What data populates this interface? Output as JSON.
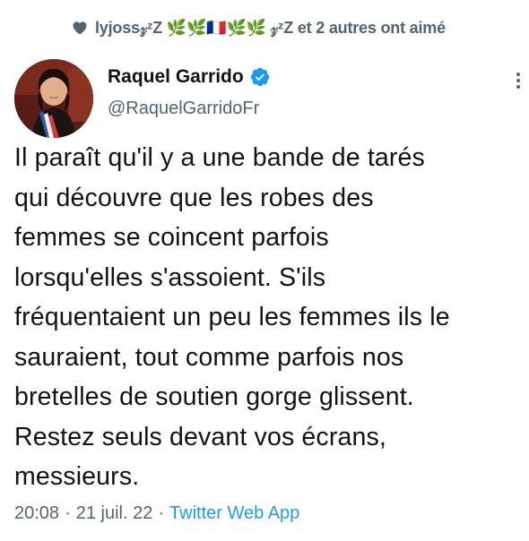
{
  "liked": {
    "user": "lyjoss",
    "decoration": "𝓏𝓏Z 🌿🌿🇫🇷🌿🌿𝓏𝓏Z",
    "suffix": "et 2 autres ont aimé",
    "icon": "heart-icon",
    "text": "lyjoss𝓏ᶻZ 🌿🌿🇫🇷🌿🌿 𝓏ᶻZ  et 2 autres ont aimé"
  },
  "author": {
    "name": "Raquel Garrido",
    "handle": "@RaquelGarridoFr",
    "verified_icon": "verified-badge-icon",
    "avatar_icon": "profile-photo"
  },
  "tweet": {
    "text": "Il paraît qu'il y a une bande de tarés\nqui découvre que les robes des\nfemmes se coincent parfois\nlorsqu'elles s'assoient. S'ils\nfréquentaient un peu les femmes ils le\nsauraient, tout comme parfois nos\nbretelles de soutien gorge glissent.\nRestez seuls devant vos écrans,\nmessieurs."
  },
  "meta": {
    "time": "20:08",
    "separator": "·",
    "date": "21 juil. 22",
    "source": "Twitter Web App"
  },
  "colors": {
    "text": "#0f1419",
    "secondary": "#536471",
    "accent": "#1d9bf0"
  }
}
